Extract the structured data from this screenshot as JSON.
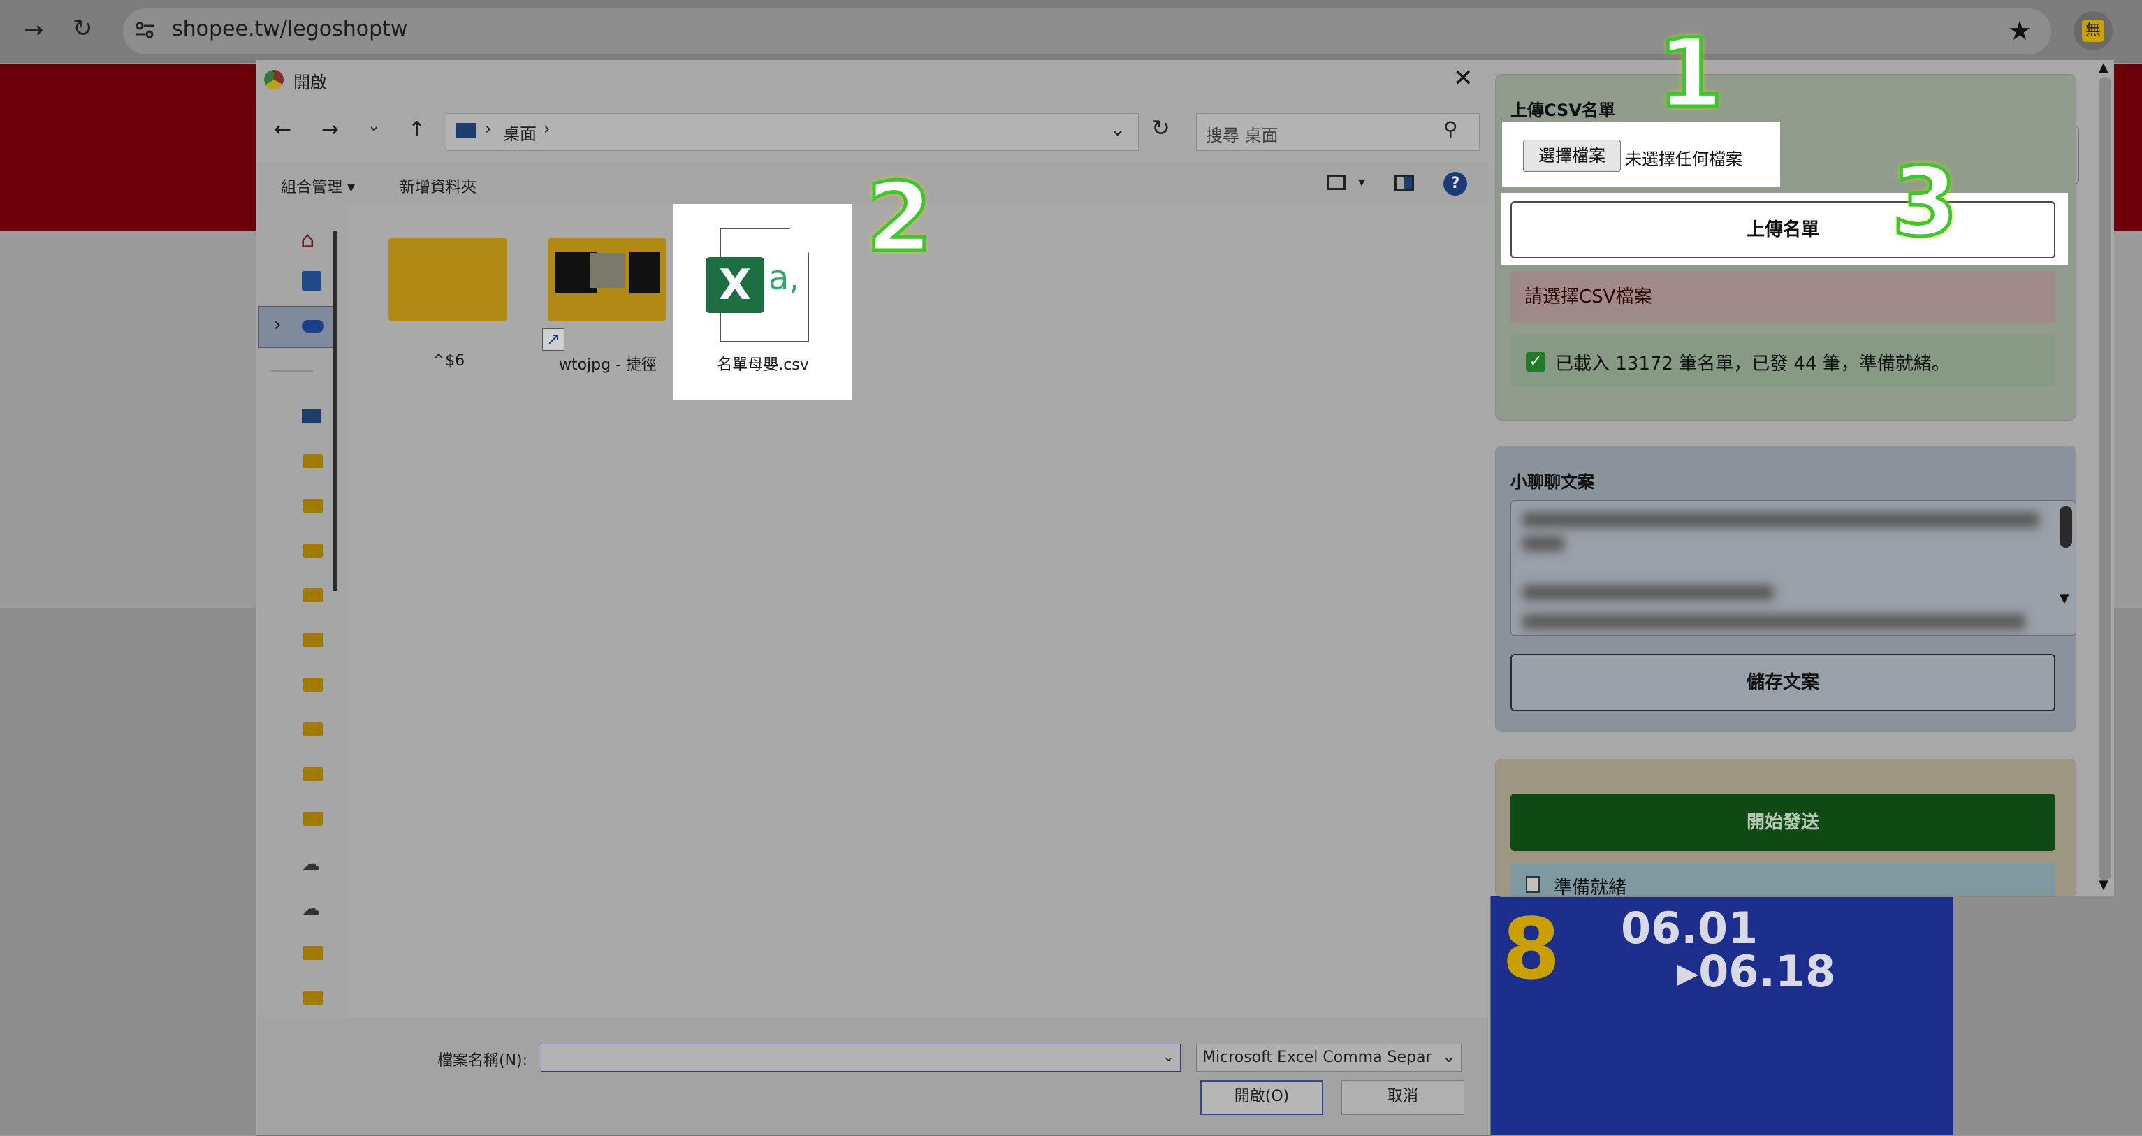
{
  "browser": {
    "url": "shopee.tw/legoshoptw",
    "extension_icon_char": "無",
    "icons": [
      "forward-icon",
      "reload-icon",
      "site-info-icon",
      "bookmark-star-icon",
      "extension-icon"
    ]
  },
  "dialog": {
    "title": "開啟",
    "close_glyph": "✕",
    "path": "桌面",
    "search_placeholder": "搜尋 桌面",
    "toolbar": {
      "organize": "組合管理 ▾",
      "new_folder": "新增資料夾"
    },
    "items": [
      {
        "label": "^$6",
        "kind": "folder"
      },
      {
        "label": "wtojpg - 捷徑",
        "kind": "shortcut-folder"
      },
      {
        "label": "名單母嬰.csv",
        "kind": "csv"
      }
    ],
    "filename_label": "檔案名稱(N):",
    "filename_value": "",
    "filetype": "Microsoft Excel Comma Separ",
    "open_button": "開啟(O)",
    "cancel_button": "取消"
  },
  "popup": {
    "upload_section_title": "上傳CSV名單",
    "choose_file_button": "選擇檔案",
    "file_status": "未選擇任何檔案",
    "upload_button": "上傳名單",
    "error_message": "請選擇CSV檔案",
    "status_message": "已載入 13172 筆名單，已發 44 筆，準備就緒。",
    "chat_section_title": "小聊聊文案",
    "save_button": "儲存文案",
    "start_button": "開始發送",
    "ready_status": "準備就緒"
  },
  "banner": {
    "date_start": "06.01",
    "date_end": "▸06.18"
  },
  "callouts": [
    "1",
    "2",
    "3"
  ],
  "colors": {
    "brand_red": "#d0011b",
    "success_green": "#1f7a2a",
    "start_green": "#0f6a14",
    "callout_green": "#38c92a",
    "callout_glow": "#f2d21a"
  }
}
